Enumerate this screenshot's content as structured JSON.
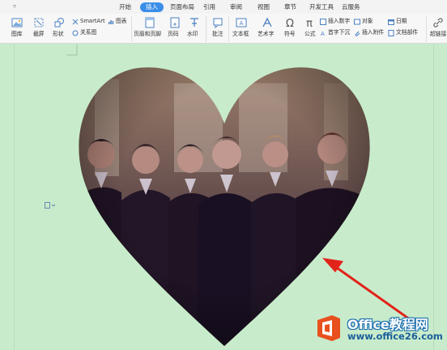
{
  "tabs": [
    {
      "label": "开始",
      "active": false
    },
    {
      "label": "插入",
      "active": true
    },
    {
      "label": "页面布局",
      "active": false
    },
    {
      "label": "引用",
      "active": false
    },
    {
      "label": "审阅",
      "active": false
    },
    {
      "label": "视图",
      "active": false
    },
    {
      "label": "章节",
      "active": false
    },
    {
      "label": "开发工具",
      "active": false
    },
    {
      "label": "云服务",
      "active": false
    }
  ],
  "ribbon": {
    "picture": "图库",
    "screenshot": "截屏",
    "shape": "形状",
    "smartart": "SmartArt",
    "chart": "图表",
    "relationship": "关系图",
    "header_footer": "页眉和页脚",
    "page_number": "页码",
    "watermark": "水印",
    "comment": "批注",
    "textbox": "文本框",
    "wordart": "艺术字",
    "symbol": "符号",
    "formula": "公式",
    "insert_number": "插入数字",
    "object": "对象",
    "dropcap": "首字下沉",
    "attachment": "插入附件",
    "date": "日期",
    "doc_parts": "文档部件",
    "hyperlink": "超链接"
  },
  "watermark": {
    "brand": "Office教程网",
    "url": "www.office26.com"
  },
  "colors": {
    "accent": "#3b8ee8",
    "page_bg": "#c8eccb",
    "arrow": "#e2231a",
    "logo": "#e8501e"
  }
}
